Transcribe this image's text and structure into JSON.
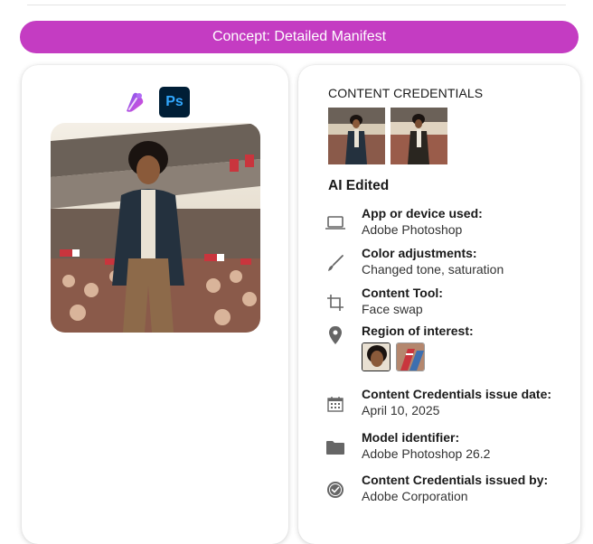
{
  "banner": {
    "title": "Concept: Detailed Manifest"
  },
  "left_card": {
    "app_icons": [
      {
        "name": "copilot-icon",
        "label": ""
      },
      {
        "name": "photoshop-icon",
        "label": "Ps"
      }
    ],
    "photo": {
      "alt": "AI edited photo"
    }
  },
  "right_card": {
    "heading": "CONTENT CREDENTIALS",
    "status": "AI Edited",
    "details": [
      {
        "icon": "laptop-icon",
        "label": "App or device used:",
        "value": "Adobe Photoshop"
      },
      {
        "icon": "brush-icon",
        "label": "Color adjustments:",
        "value": "Changed tone, saturation"
      },
      {
        "icon": "crop-icon",
        "label": "Content Tool:",
        "value": "Face swap"
      },
      {
        "icon": "location-pin-icon",
        "label": "Region of interest:",
        "value": ""
      },
      {
        "icon": "calendar-icon",
        "label": "Content Credentials issue date:",
        "value": "April 10, 2025"
      },
      {
        "icon": "folder-icon",
        "label": "Model identifier:",
        "value": "Adobe Photoshop 26.2"
      },
      {
        "icon": "verified-badge-icon",
        "label": "Content Credentials issued by:",
        "value": "Adobe Corporation"
      }
    ]
  },
  "colors": {
    "banner": "#c43cc2",
    "photoshop_bg": "#001e36",
    "photoshop_fg": "#31a8ff"
  }
}
